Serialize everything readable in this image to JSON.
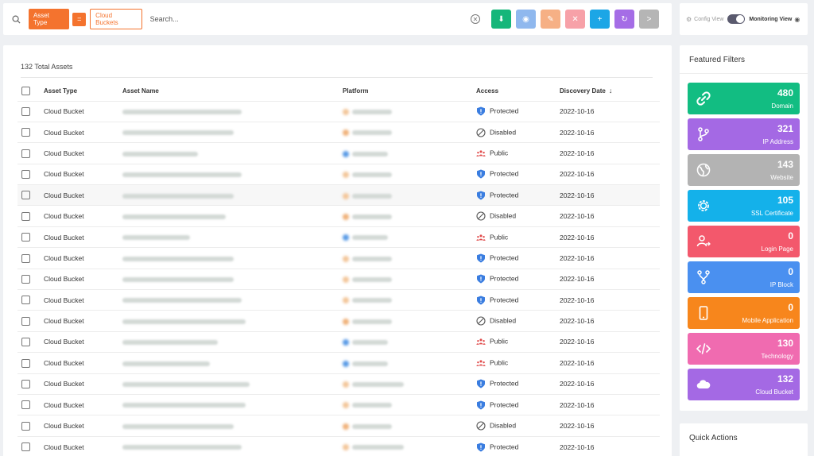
{
  "topbar": {
    "chip_asset_type": "Asset Type",
    "chip_operator": "=",
    "chip_value": "Cloud Buckets",
    "search_placeholder": "Search...",
    "buttons": [
      {
        "name": "download",
        "color": "#16b67a",
        "glyph": "⬇"
      },
      {
        "name": "view",
        "color": "#8fb8ee",
        "glyph": "◉"
      },
      {
        "name": "tag",
        "color": "#f6b085",
        "glyph": "✎"
      },
      {
        "name": "untag",
        "color": "#f7a1a8",
        "glyph": "✕"
      },
      {
        "name": "add",
        "color": "#1ca6e6",
        "glyph": "+"
      },
      {
        "name": "refresh",
        "color": "#a56de6",
        "glyph": "↻"
      },
      {
        "name": "next",
        "color": "#b5b5b5",
        "glyph": ">"
      }
    ]
  },
  "view": {
    "config_label": "Config View",
    "monitoring_label": "Monitoring View"
  },
  "assets": {
    "total_label": "132 Total Assets",
    "columns": [
      "Asset Type",
      "Asset Name",
      "Platform",
      "Access",
      "Discovery Date"
    ],
    "rows": [
      {
        "type": "Cloud Bucket",
        "access": "Protected",
        "date": "2022-10-16"
      },
      {
        "type": "Cloud Bucket",
        "access": "Disabled",
        "date": "2022-10-16"
      },
      {
        "type": "Cloud Bucket",
        "access": "Public",
        "date": "2022-10-16"
      },
      {
        "type": "Cloud Bucket",
        "access": "Protected",
        "date": "2022-10-16"
      },
      {
        "type": "Cloud Bucket",
        "access": "Protected",
        "date": "2022-10-16"
      },
      {
        "type": "Cloud Bucket",
        "access": "Disabled",
        "date": "2022-10-16"
      },
      {
        "type": "Cloud Bucket",
        "access": "Public",
        "date": "2022-10-16"
      },
      {
        "type": "Cloud Bucket",
        "access": "Protected",
        "date": "2022-10-16"
      },
      {
        "type": "Cloud Bucket",
        "access": "Protected",
        "date": "2022-10-16"
      },
      {
        "type": "Cloud Bucket",
        "access": "Protected",
        "date": "2022-10-16"
      },
      {
        "type": "Cloud Bucket",
        "access": "Disabled",
        "date": "2022-10-16"
      },
      {
        "type": "Cloud Bucket",
        "access": "Public",
        "date": "2022-10-16"
      },
      {
        "type": "Cloud Bucket",
        "access": "Public",
        "date": "2022-10-16"
      },
      {
        "type": "Cloud Bucket",
        "access": "Protected",
        "date": "2022-10-16"
      },
      {
        "type": "Cloud Bucket",
        "access": "Protected",
        "date": "2022-10-16"
      },
      {
        "type": "Cloud Bucket",
        "access": "Disabled",
        "date": "2022-10-16"
      },
      {
        "type": "Cloud Bucket",
        "access": "Protected",
        "date": "2022-10-16"
      }
    ]
  },
  "filters": {
    "title": "Featured Filters",
    "cards": [
      {
        "count": "480",
        "label": "Domain",
        "color": "#12bd82",
        "icon": "link-icon"
      },
      {
        "count": "321",
        "label": "IP Address",
        "color": "#a469e4",
        "icon": "branch-icon"
      },
      {
        "count": "143",
        "label": "Website",
        "color": "#b3b3b3",
        "icon": "globe-icon"
      },
      {
        "count": "105",
        "label": "SSL Certificate",
        "color": "#14b1ea",
        "icon": "gear-icon"
      },
      {
        "count": "0",
        "label": "Login Page",
        "color": "#f3586c",
        "icon": "user-login-icon"
      },
      {
        "count": "0",
        "label": "IP Block",
        "color": "#4a90f0",
        "icon": "fork-icon"
      },
      {
        "count": "0",
        "label": "Mobile Application",
        "color": "#f7861c",
        "icon": "mobile-icon"
      },
      {
        "count": "130",
        "label": "Technology",
        "color": "#f06bb0",
        "icon": "code-icon"
      },
      {
        "count": "132",
        "label": "Cloud Bucket",
        "color": "#a469e4",
        "icon": "cloud-icon"
      }
    ]
  },
  "quick_actions": {
    "title": "Quick Actions"
  }
}
